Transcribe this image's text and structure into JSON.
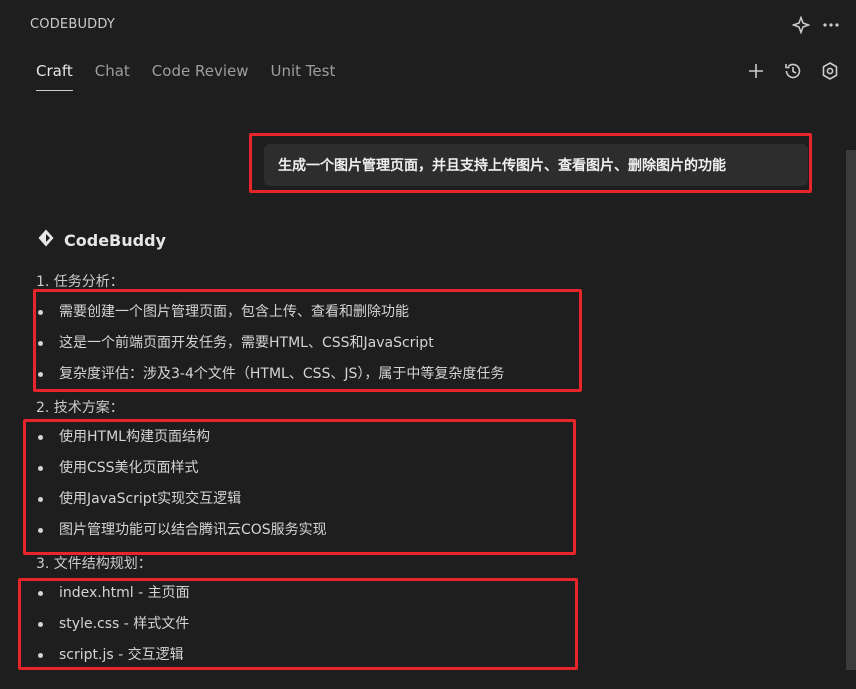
{
  "app": {
    "title": "CODEBUDDY"
  },
  "tabs": [
    {
      "label": "Craft",
      "active": true
    },
    {
      "label": "Chat",
      "active": false
    },
    {
      "label": "Code Review",
      "active": false
    },
    {
      "label": "Unit Test",
      "active": false
    }
  ],
  "icons": {
    "top": [
      "sparkle-grid-icon",
      "more-horizontal-icon"
    ],
    "toolbar": [
      "plus-icon",
      "history-icon",
      "settings-icon"
    ]
  },
  "chat": {
    "user_message": "生成一个图片管理页面，并且支持上传图片、查看图片、删除图片的功能",
    "assistant_name": "CodeBuddy",
    "sections": [
      {
        "title": "1. 任务分析：",
        "items": [
          "需要创建一个图片管理页面，包含上传、查看和删除功能",
          "这是一个前端页面开发任务，需要HTML、CSS和JavaScript",
          "复杂度评估：涉及3-4个文件（HTML、CSS、JS），属于中等复杂度任务"
        ]
      },
      {
        "title": "2. 技术方案：",
        "items": [
          "使用HTML构建页面结构",
          "使用CSS美化页面样式",
          "使用JavaScript实现交互逻辑",
          "图片管理功能可以结合腾讯云COS服务实现"
        ]
      },
      {
        "title": "3. 文件结构规划：",
        "items": [
          "index.html - 主页面",
          "style.css - 样式文件",
          "script.js - 交互逻辑"
        ]
      }
    ]
  },
  "colors": {
    "background": "#1e1e1e",
    "bubble": "#2d2d2d",
    "highlight": "#e8252b",
    "text": "#d4d4d4"
  }
}
